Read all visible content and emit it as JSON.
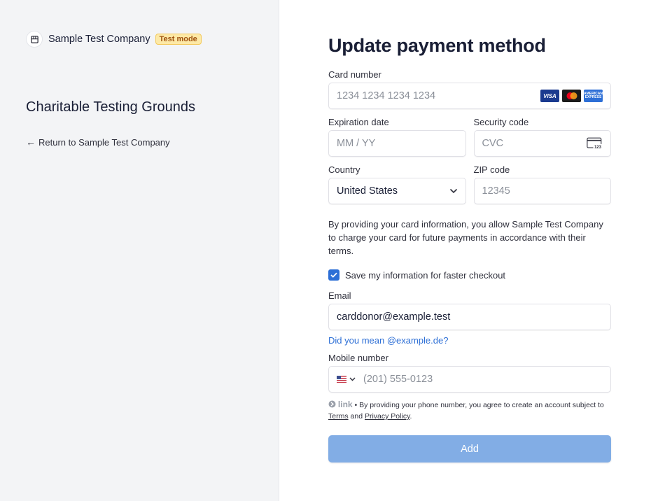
{
  "brand": {
    "name": "Sample Test Company",
    "badge": "Test mode"
  },
  "merchant_title": "Charitable Testing Grounds",
  "return_link": "Return to Sample Test Company",
  "form": {
    "title": "Update payment method",
    "card_number": {
      "label": "Card number",
      "placeholder": "1234 1234 1234 1234"
    },
    "card_brands": [
      "VISA",
      "mastercard",
      "AMERICAN EXPRESS"
    ],
    "expiration": {
      "label": "Expiration date",
      "placeholder": "MM / YY"
    },
    "security": {
      "label": "Security code",
      "placeholder": "CVC",
      "icon_text": "123"
    },
    "country": {
      "label": "Country",
      "value": "United States"
    },
    "zip": {
      "label": "ZIP code",
      "placeholder": "12345"
    },
    "notice": "By providing your card information, you allow Sample Test Company to charge your card for future payments in accordance with their terms.",
    "save_info": {
      "label": "Save my information for faster checkout",
      "checked": true
    },
    "email": {
      "label": "Email",
      "value": "carddonor@example.test"
    },
    "email_suggestion": "Did you mean @example.de?",
    "mobile": {
      "label": "Mobile number",
      "placeholder": "(201) 555-0123"
    },
    "link_notice": {
      "logo": "link",
      "text_before": "• By providing your phone number, you agree to create an account subject to",
      "terms": "Terms",
      "and": "and",
      "privacy": "Privacy Policy",
      "end": "."
    },
    "submit_label": "Add"
  },
  "colors": {
    "accent": "#2d6fd6",
    "button_disabled": "#82ade5",
    "badge_bg": "#fde9a6",
    "left_panel_bg": "#f3f4f6"
  }
}
